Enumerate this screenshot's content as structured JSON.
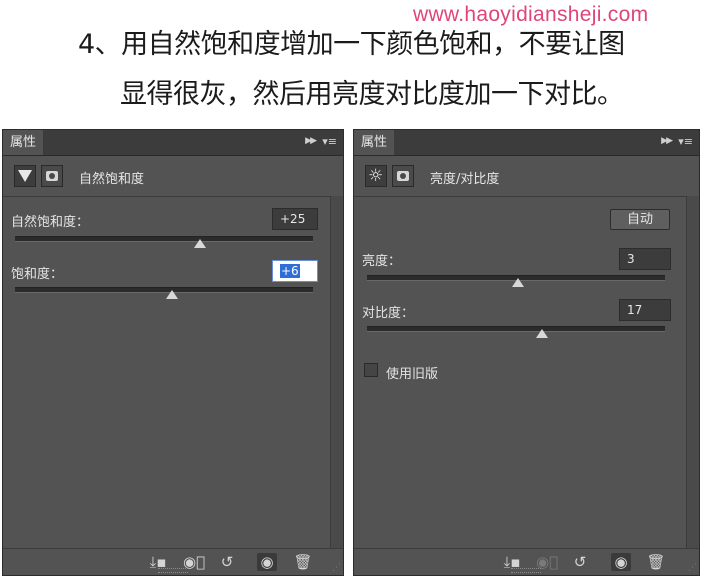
{
  "watermark": "www.haoyidiansheji.com",
  "caption": {
    "line1": "4、用自然饱和度增加一下颜色饱和，不要让图",
    "line2": "显得很灰，然后用亮度对比度加一下对比。"
  },
  "panels": [
    {
      "tab": "属性",
      "header_title": "自然饱和度",
      "header_icon": "vibrance-triangle-icon",
      "controls": [
        {
          "label": "自然饱和度：",
          "value": "+25",
          "level": 0.62
        },
        {
          "label": "饱和度：",
          "value": "+6",
          "level": 0.53
        }
      ]
    },
    {
      "tab": "属性",
      "header_title": "亮度/对比度",
      "header_icon": "brightness-sun-icon",
      "auto_label": "自动",
      "controls": [
        {
          "label": "亮度：",
          "value": "3",
          "level": 0.51
        },
        {
          "label": "对比度：",
          "value": "17",
          "level": 0.59
        }
      ],
      "legacy_label": "使用旧版"
    }
  ],
  "icons": {
    "collapse": "double-chevron-right-icon",
    "menu": "panel-menu-icon",
    "clip": "clip-to-layer-icon",
    "view_prev": "view-previous-state-icon",
    "reset": "reset-icon",
    "visibility": "eye-icon",
    "delete": "trash-icon"
  },
  "colors": {
    "panel_bg": "#535353",
    "watermark": "#e0457a",
    "selection": "#2e6ed6"
  }
}
